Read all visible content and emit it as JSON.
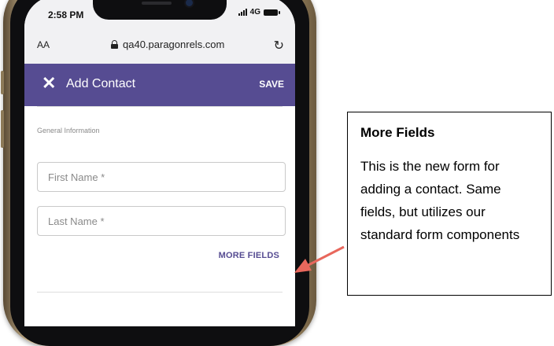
{
  "status_bar": {
    "time": "2:58 PM",
    "network": "4G"
  },
  "browser": {
    "text_size_label": "AA",
    "url": "qa40.paragonrels.com"
  },
  "app_bar": {
    "title": "Add Contact",
    "save_label": "SAVE"
  },
  "form": {
    "section_label": "General Information",
    "first_name_placeholder": "First Name *",
    "last_name_placeholder": "Last Name *",
    "more_fields_label": "MORE FIELDS"
  },
  "callout": {
    "title": "More Fields",
    "body": "This is the new form for adding a contact. Same fields, but utilizes our standard form components"
  },
  "colors": {
    "app_bar": "#564c92",
    "arrow": "#e8675c"
  }
}
